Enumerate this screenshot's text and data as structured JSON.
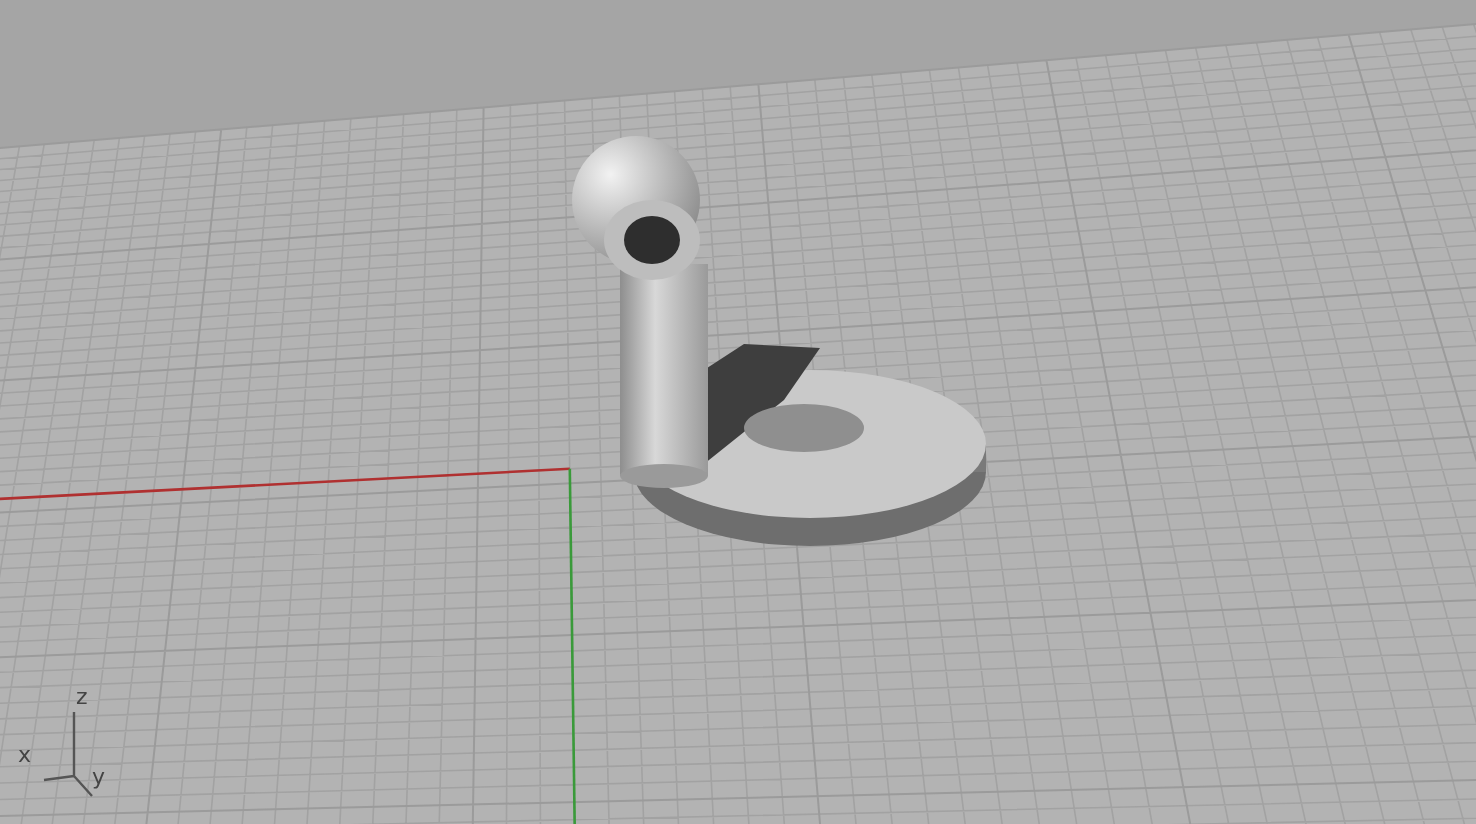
{
  "viewport": {
    "axis_labels": [
      {
        "kind": "z",
        "label": "z"
      },
      {
        "kind": "x",
        "label": "x"
      },
      {
        "kind": "y",
        "label": "y"
      }
    ]
  }
}
